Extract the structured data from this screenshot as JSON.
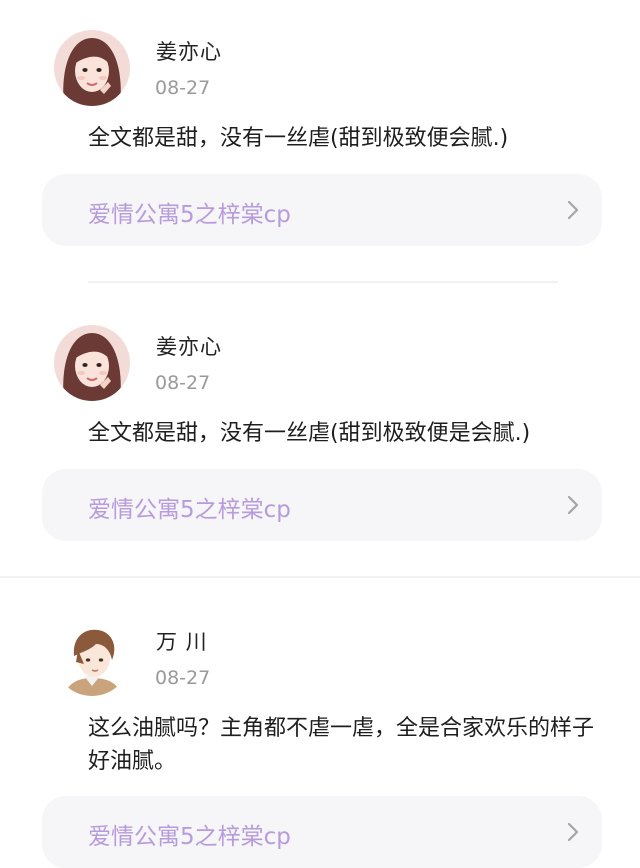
{
  "comments": [
    {
      "username": "姜亦心",
      "date": "08-27",
      "text": "全文都是甜，没有一丝虐(甜到极致便会腻.)",
      "book_title": "爱情公寓5之梓棠cp",
      "avatar": "female-avatar"
    },
    {
      "username": "姜亦心",
      "date": "08-27",
      "text": "全文都是甜，没有一丝虐(甜到极致便是会腻.)",
      "book_title": "爱情公寓5之梓棠cp",
      "avatar": "female-avatar"
    },
    {
      "username": "万 川",
      "date": "08-27",
      "text": "这么油腻吗？主角都不虐一虐，全是合家欢乐的样子好油腻。",
      "book_title": "爱情公寓5之梓棠cp",
      "avatar": "male-anime-avatar"
    }
  ],
  "colors": {
    "book_title": "#b79bdc",
    "book_card_bg": "#f6f6f8",
    "date": "#9a9a9a",
    "divider": "#f1f1f3"
  }
}
